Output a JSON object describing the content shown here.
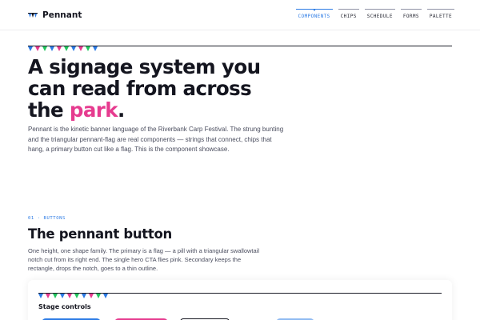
{
  "header": {
    "brand_name": "Pennant",
    "brand_icon": "bunting-logo-icon",
    "nav": [
      {
        "label": "COMPONENTS",
        "active": true
      },
      {
        "label": "CHIPS",
        "active": false
      },
      {
        "label": "SCHEDULE",
        "active": false
      },
      {
        "label": "FORMS",
        "active": false
      },
      {
        "label": "PALETTE",
        "active": false
      }
    ]
  },
  "hero": {
    "title_lead": "A signage system you can read from across the ",
    "title_accent": "park",
    "title_end": ".",
    "description": "Pennant is the kinetic banner language of the Riverbank Carp Festival. The strung bunting and the triangular pennant-flag are real components — strings that connect, chips that hang, a primary button cut like a flag. This is the component showcase."
  },
  "section": {
    "kicker": "01 · BUTTONS",
    "title": "The pennant button",
    "description": "One height, one shape family. The primary is a flag — a pill with a triangular swallowtail notch cut from its right end. The single hero CTA flies pink. Secondary keeps the rectangle, drops the notch, goes to a thin outline."
  },
  "stage": {
    "title": "Stage controls"
  },
  "colors": {
    "ink": "#14151f",
    "blue": "#2c7be5",
    "pink": "#e63b8f",
    "green": "#22c55e",
    "light_blue": "#8fbaf2"
  },
  "bunting_colors": [
    "#2c7be5",
    "#e63b8f",
    "#22c55e",
    "#2c7be5",
    "#e63b8f",
    "#22c55e",
    "#2c7be5",
    "#e63b8f",
    "#22c55e",
    "#2c7be5"
  ]
}
